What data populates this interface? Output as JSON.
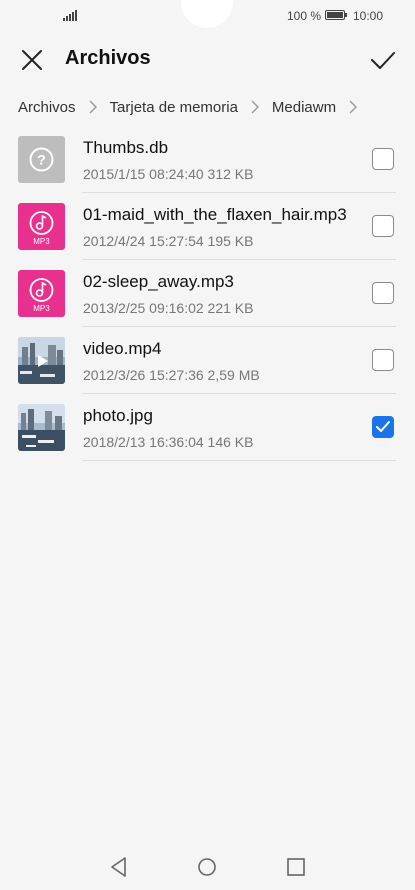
{
  "status_bar": {
    "battery": "100 %",
    "time": "10:00"
  },
  "header": {
    "title": "Archivos",
    "close_icon": "close-icon",
    "confirm_icon": "checkmark-icon"
  },
  "breadcrumb": {
    "items": [
      "Archivos",
      "Tarjeta de memoria",
      "Mediawm"
    ]
  },
  "files": [
    {
      "name": "Thumbs.db",
      "meta": "2015/1/15 08:24:40 312 KB",
      "icon": "unknown-file-icon",
      "checked": false
    },
    {
      "name": "01-maid_with_the_flaxen_hair.mp3",
      "meta": "2012/4/24 15:27:54 195 KB",
      "icon": "music-file-icon",
      "badge": "MP3",
      "checked": false
    },
    {
      "name": "02-sleep_away.mp3",
      "meta": "2013/2/25 09:16:02 221 KB",
      "icon": "music-file-icon",
      "badge": "MP3",
      "checked": false
    },
    {
      "name": "video.mp4",
      "meta": "2012/3/26 15:27:36 2,59 MB",
      "icon": "video-thumbnail",
      "checked": false
    },
    {
      "name": "photo.jpg",
      "meta": "2018/2/13 16:36:04 146 KB",
      "icon": "photo-thumbnail",
      "checked": true
    }
  ],
  "colors": {
    "accent": "#1a73e8",
    "mp3": "#e8318f"
  },
  "nav": {
    "back": "back-icon",
    "home": "home-icon",
    "recent": "recent-apps-icon"
  }
}
